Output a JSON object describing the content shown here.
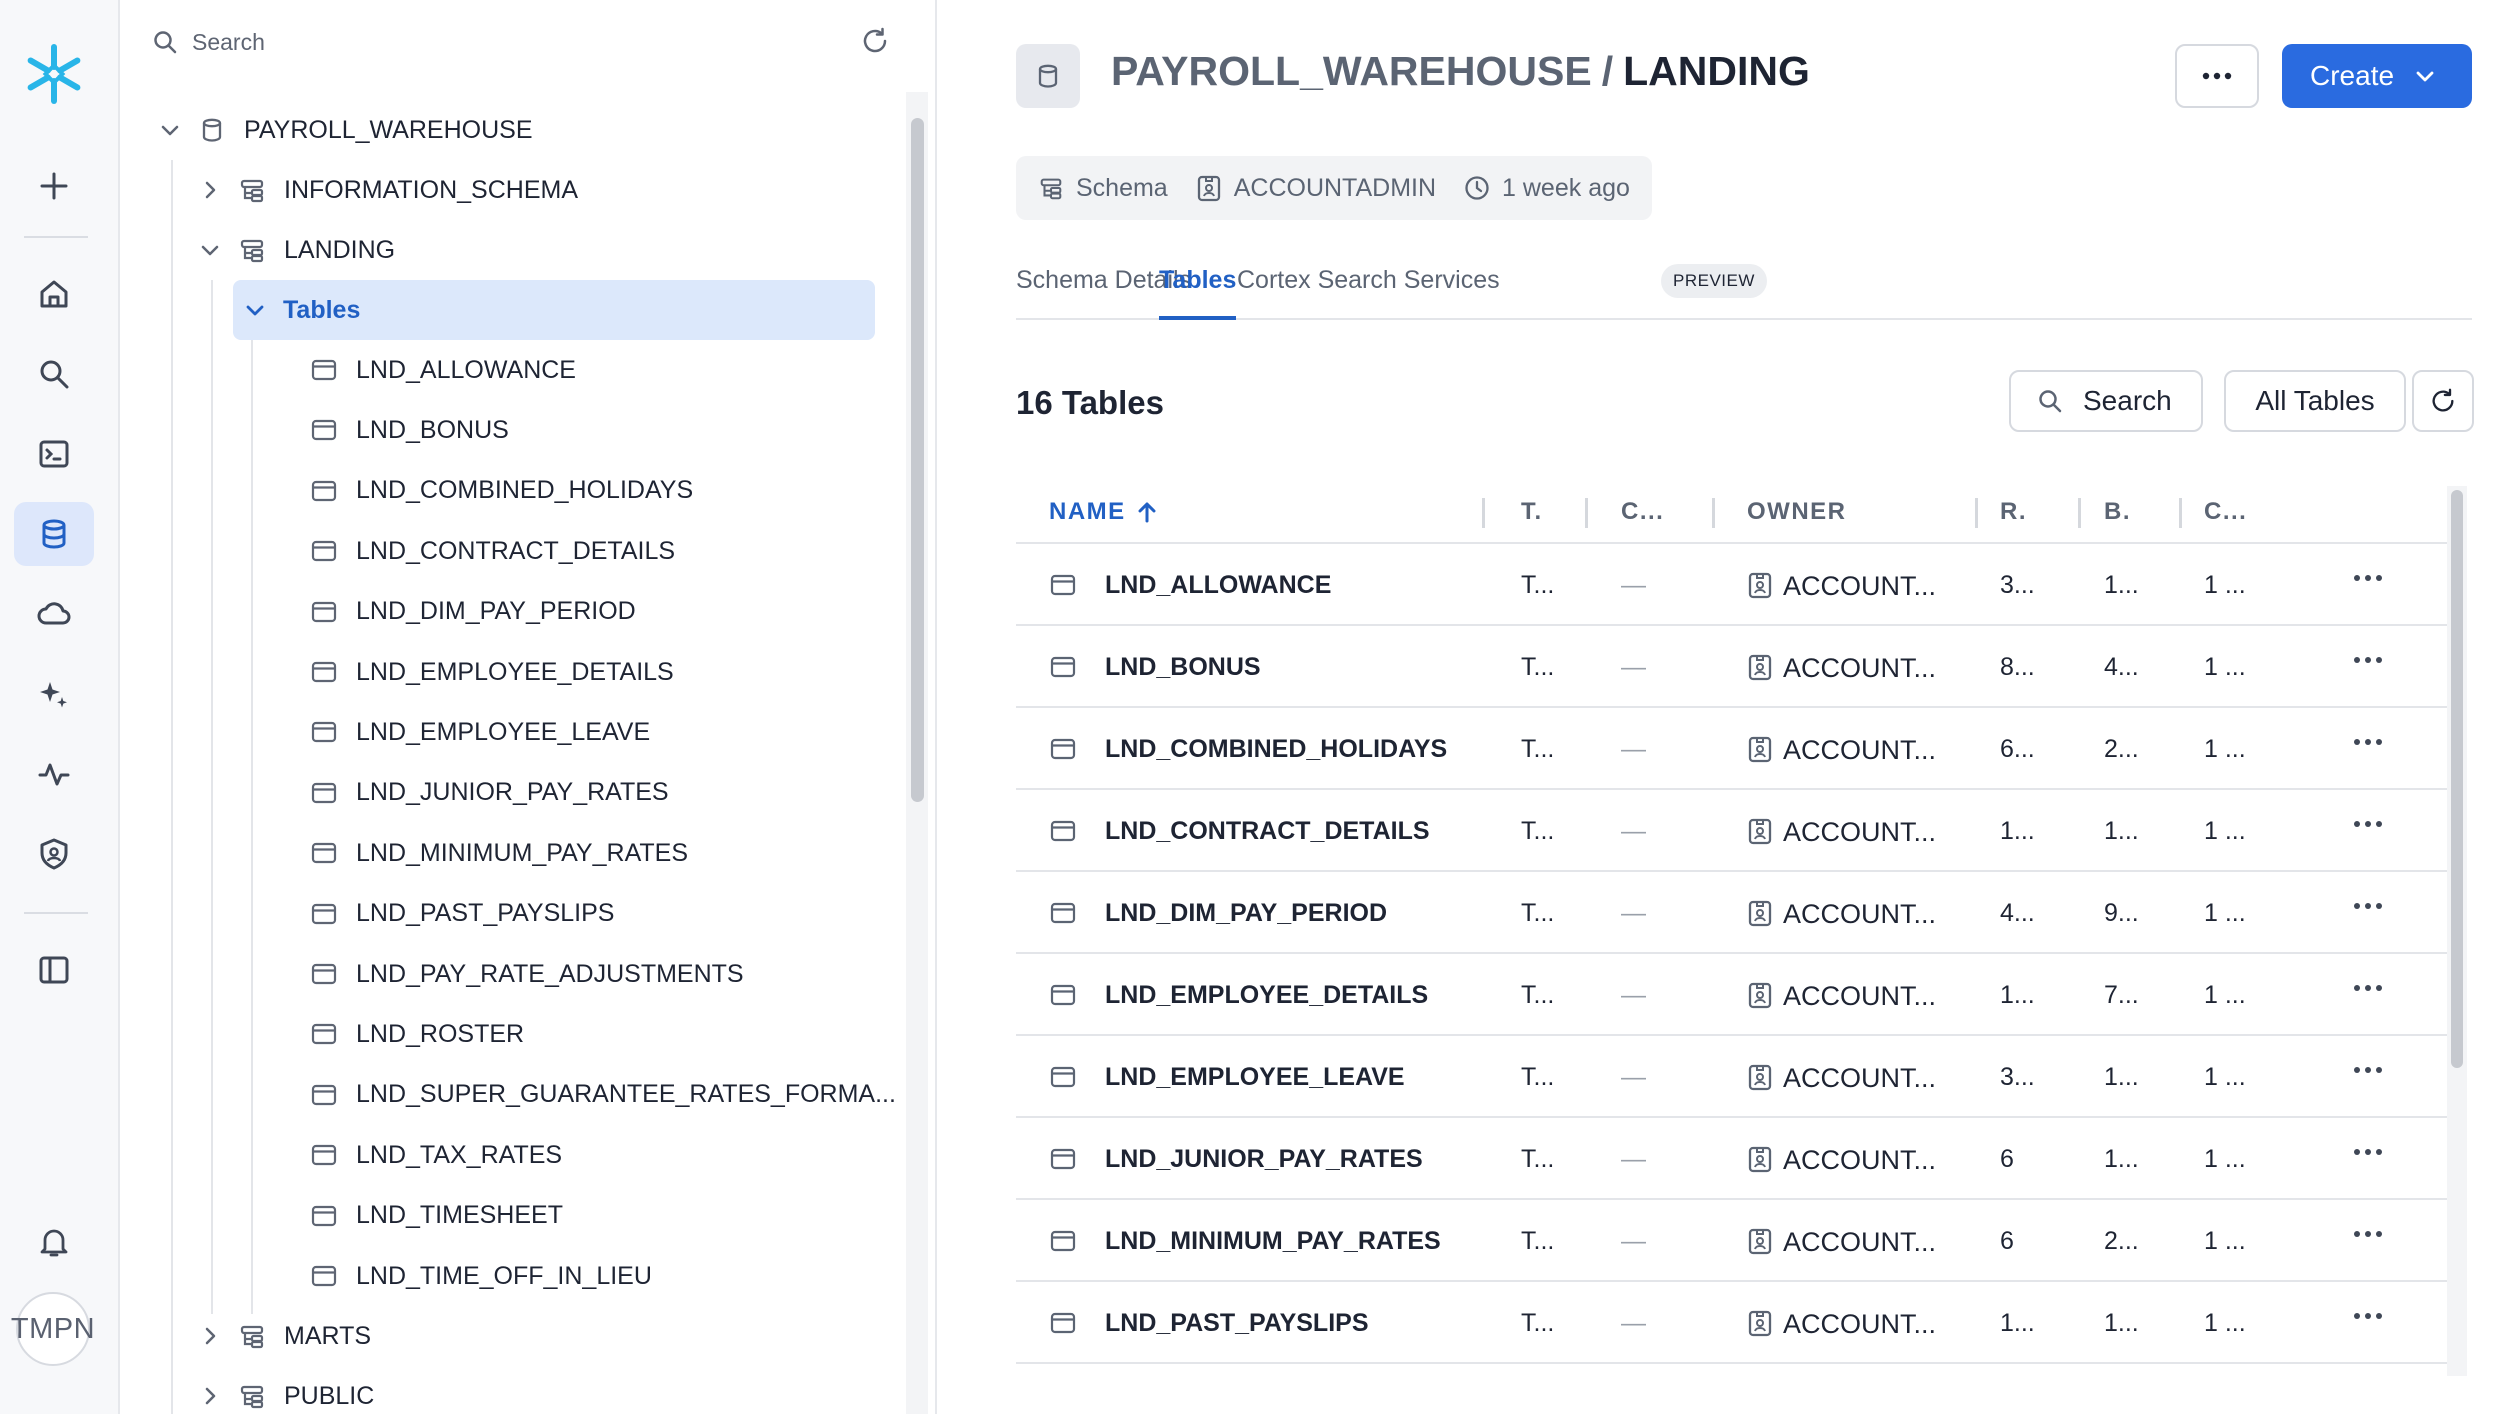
{
  "rail": {
    "user_initials": "TMPN",
    "active": "data"
  },
  "tree": {
    "search_placeholder": "Search",
    "database": "PAYROLL_WAREHOUSE",
    "schemas_before": [
      "INFORMATION_SCHEMA"
    ],
    "expanded_schema": "LANDING",
    "tables_node": "Tables",
    "tables": [
      "LND_ALLOWANCE",
      "LND_BONUS",
      "LND_COMBINED_HOLIDAYS",
      "LND_CONTRACT_DETAILS",
      "LND_DIM_PAY_PERIOD",
      "LND_EMPLOYEE_DETAILS",
      "LND_EMPLOYEE_LEAVE",
      "LND_JUNIOR_PAY_RATES",
      "LND_MINIMUM_PAY_RATES",
      "LND_PAST_PAYSLIPS",
      "LND_PAY_RATE_ADJUSTMENTS",
      "LND_ROSTER",
      "LND_SUPER_GUARANTEE_RATES_FORMA...",
      "LND_TAX_RATES",
      "LND_TIMESHEET",
      "LND_TIME_OFF_IN_LIEU"
    ],
    "schemas_after": [
      "MARTS",
      "PUBLIC"
    ]
  },
  "header": {
    "database": "PAYROLL_WAREHOUSE",
    "separator": "/",
    "schema": "LANDING",
    "create_label": "Create"
  },
  "meta": {
    "kind": "Schema",
    "owner": "ACCOUNTADMIN",
    "updated": "1 week ago"
  },
  "tabs": {
    "details": "Schema Details",
    "tables": "Tables",
    "cortex": "Cortex Search Services",
    "preview_badge": "PREVIEW"
  },
  "list": {
    "count_label": "16 Tables",
    "search_label": "Search",
    "filter_label": "All Tables",
    "columns": {
      "name": "NAME",
      "type": "T.",
      "cluster": "C...",
      "owner": "OWNER",
      "rows": "R.",
      "bytes": "B.",
      "created": "C..."
    },
    "rows": [
      {
        "name": "LND_ALLOWANCE",
        "type": "T...",
        "cluster": "—",
        "owner": "ACCOUNT...",
        "rows": "3...",
        "bytes": "1...",
        "created": "1 ..."
      },
      {
        "name": "LND_BONUS",
        "type": "T...",
        "cluster": "—",
        "owner": "ACCOUNT...",
        "rows": "8...",
        "bytes": "4...",
        "created": "1 ..."
      },
      {
        "name": "LND_COMBINED_HOLIDAYS",
        "type": "T...",
        "cluster": "—",
        "owner": "ACCOUNT...",
        "rows": "6...",
        "bytes": "2...",
        "created": "1 ..."
      },
      {
        "name": "LND_CONTRACT_DETAILS",
        "type": "T...",
        "cluster": "—",
        "owner": "ACCOUNT...",
        "rows": "1...",
        "bytes": "1...",
        "created": "1 ..."
      },
      {
        "name": "LND_DIM_PAY_PERIOD",
        "type": "T...",
        "cluster": "—",
        "owner": "ACCOUNT...",
        "rows": "4...",
        "bytes": "9...",
        "created": "1 ..."
      },
      {
        "name": "LND_EMPLOYEE_DETAILS",
        "type": "T...",
        "cluster": "—",
        "owner": "ACCOUNT...",
        "rows": "1...",
        "bytes": "7...",
        "created": "1 ..."
      },
      {
        "name": "LND_EMPLOYEE_LEAVE",
        "type": "T...",
        "cluster": "—",
        "owner": "ACCOUNT...",
        "rows": "3...",
        "bytes": "1...",
        "created": "1 ..."
      },
      {
        "name": "LND_JUNIOR_PAY_RATES",
        "type": "T...",
        "cluster": "—",
        "owner": "ACCOUNT...",
        "rows": "6",
        "bytes": "1...",
        "created": "1 ..."
      },
      {
        "name": "LND_MINIMUM_PAY_RATES",
        "type": "T...",
        "cluster": "—",
        "owner": "ACCOUNT...",
        "rows": "6",
        "bytes": "2...",
        "created": "1 ..."
      },
      {
        "name": "LND_PAST_PAYSLIPS",
        "type": "T...",
        "cluster": "—",
        "owner": "ACCOUNT...",
        "rows": "1...",
        "bytes": "1...",
        "created": "1 ..."
      }
    ]
  }
}
